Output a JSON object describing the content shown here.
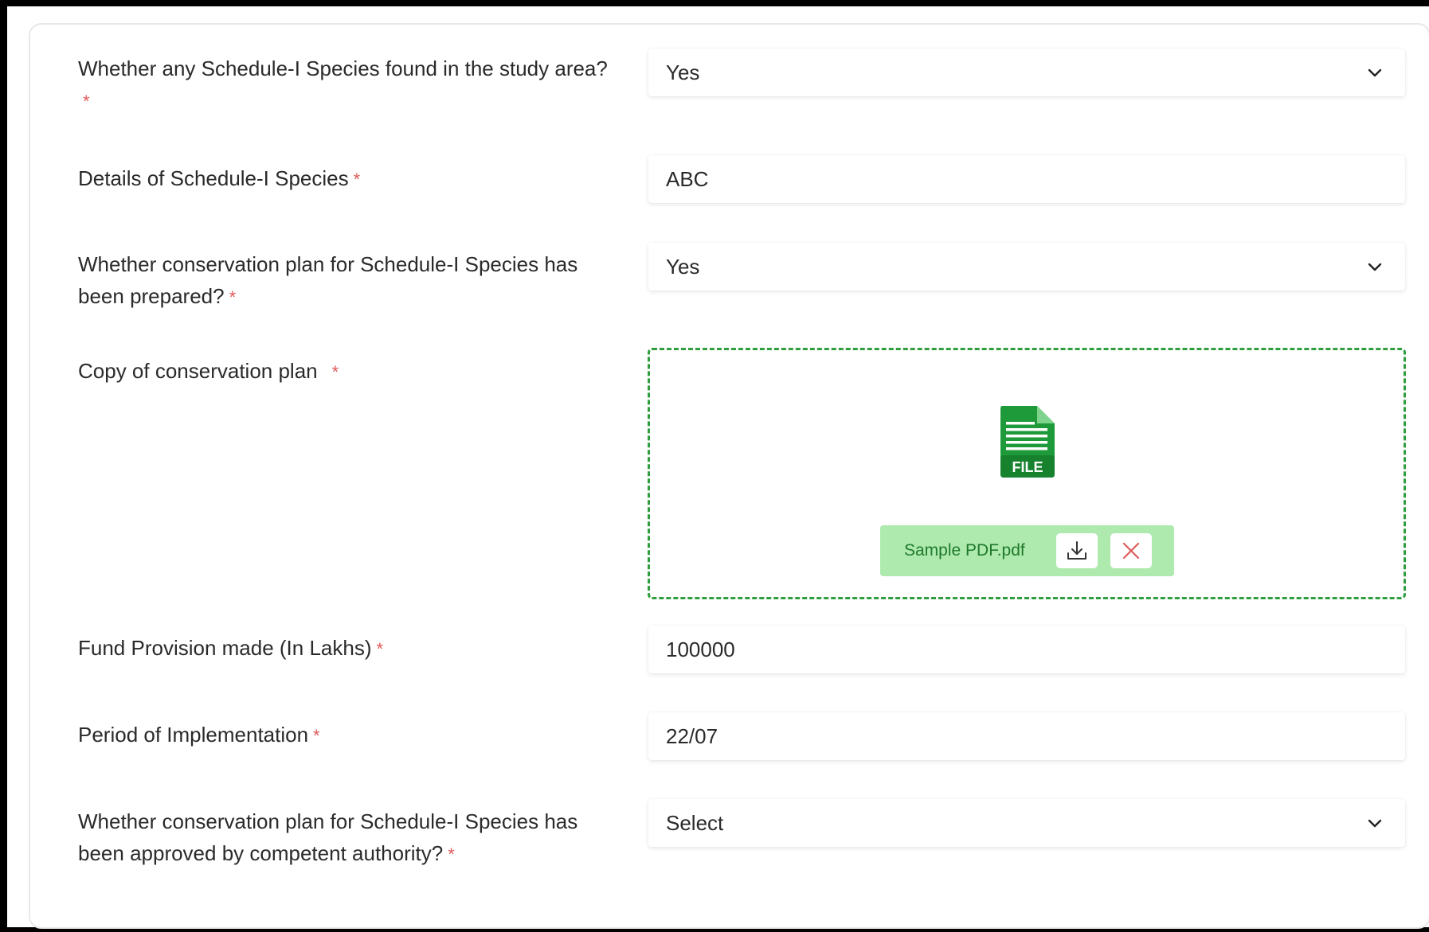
{
  "form": {
    "required_mark": "*",
    "q_schedule_species_found": {
      "label": "Whether any Schedule-I Species found in the study area?",
      "value": "Yes"
    },
    "q_species_details": {
      "label": "Details of Schedule-I Species",
      "value": "ABC"
    },
    "q_plan_prepared": {
      "label": "Whether conservation plan for Schedule-I Species has been prepared?",
      "value": "Yes"
    },
    "q_plan_copy": {
      "label": "Copy of conservation plan",
      "file_icon_text": "FILE",
      "file_name": "Sample PDF.pdf"
    },
    "q_fund_provision": {
      "label": "Fund Provision made (In Lakhs)",
      "value": "100000"
    },
    "q_period": {
      "label": "Period of Implementation",
      "value": "22/07"
    },
    "q_plan_approved": {
      "label": "Whether conservation plan for Schedule-I Species has been approved by competent authority?",
      "value": "Select"
    }
  },
  "icons": {
    "dropdown": "chevron-down-icon",
    "file": "file-document-icon",
    "download": "download-icon",
    "remove": "close-icon"
  },
  "colors": {
    "required": "#e05a5a",
    "upload_border": "#2e9e3e",
    "file_chip_bg": "#aee9ae",
    "file_icon": "#1e9a3a",
    "remove_icon": "#e05a5a"
  }
}
